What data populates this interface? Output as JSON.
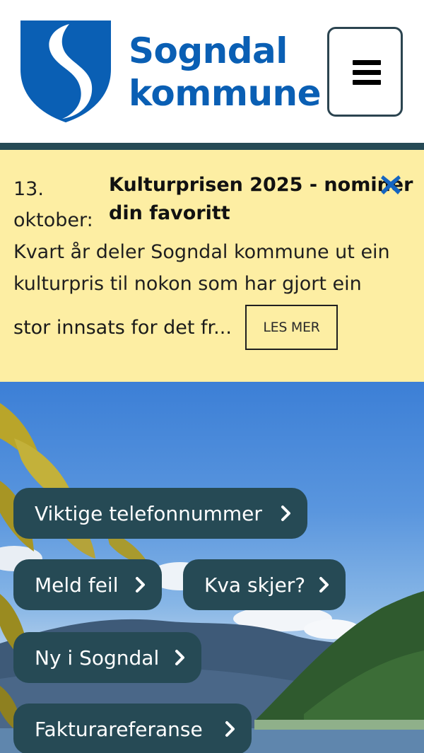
{
  "header": {
    "logo_line1": "Sogndal",
    "logo_line2": "kommune",
    "brand_color": "#0a5fb4",
    "menu_icon": "hamburger-icon"
  },
  "notice": {
    "date_line1": "13.",
    "date_line2": "oktober:",
    "title_line1": "Kulturprisen 2025 - nominer",
    "title_line2": "din favoritt",
    "body_line1": "Kvart år deler Sogndal kommune ut ein",
    "body_line2": "kulturpris til nokon som har gjort ein",
    "body_line3": "stor innsats for det fr...",
    "read_more": "LES MER",
    "close_icon": "close-icon",
    "background": "#fdeea3"
  },
  "quick_links": [
    {
      "label": "Viktige telefonnummer"
    },
    {
      "label": "Meld feil"
    },
    {
      "label": "Kva skjer?"
    },
    {
      "label": "Ny i Sogndal"
    },
    {
      "label": "Fakturareferanse"
    }
  ],
  "colors": {
    "button_bg": "#264a55",
    "divider": "#264a55"
  }
}
